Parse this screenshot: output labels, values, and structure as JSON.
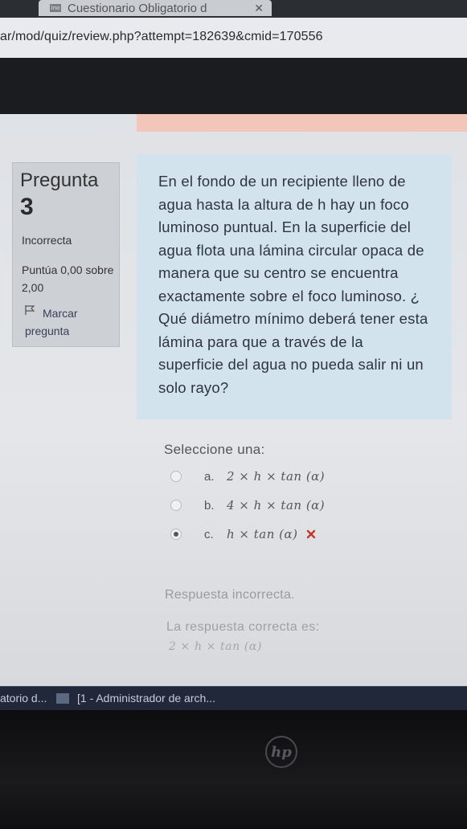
{
  "browser": {
    "tab_title": "Cuestionario Obligatorio d",
    "tab_favicon_text": "ino",
    "url": "ar/mod/quiz/review.php?attempt=182639&cmid=170556"
  },
  "question_info": {
    "label": "Pregunta",
    "number": "3",
    "state": "Incorrecta",
    "grade": "Puntúa 0,00 sobre 2,00",
    "flag_label": "Marcar pregunta"
  },
  "question": {
    "text": "En el fondo de un recipiente lleno de agua hasta la altura de  h hay un foco luminoso puntual. En la superficie del agua flota una lámina circular opaca de manera que su centro se encuentra exactamente sobre el foco luminoso. ¿ Qué diámetro mínimo deberá tener esta lámina para que a través de la superficie del agua no pueda salir ni un solo rayo?",
    "select_label": "Seleccione una:",
    "options": [
      {
        "letter": "a.",
        "text": "2 × h × tan (α)",
        "checked": false
      },
      {
        "letter": "b.",
        "text": "4 × h × tan (α)",
        "checked": false
      },
      {
        "letter": "c.",
        "text": "h × tan (α)",
        "checked": true
      }
    ],
    "feedback": "Respuesta incorrecta.",
    "correct_answer_label": "La respuesta correcta es:",
    "correct_answer_value": "2 × h × tan (α)"
  },
  "taskbar": {
    "item1": "atorio d...",
    "item2": "[1 - Administrador de arch..."
  },
  "hardware": {
    "logo": "hp"
  },
  "colors": {
    "question_box": "#d2e3ee",
    "info_box": "#cdd1d6",
    "wrong_mark": "#c0392b"
  }
}
